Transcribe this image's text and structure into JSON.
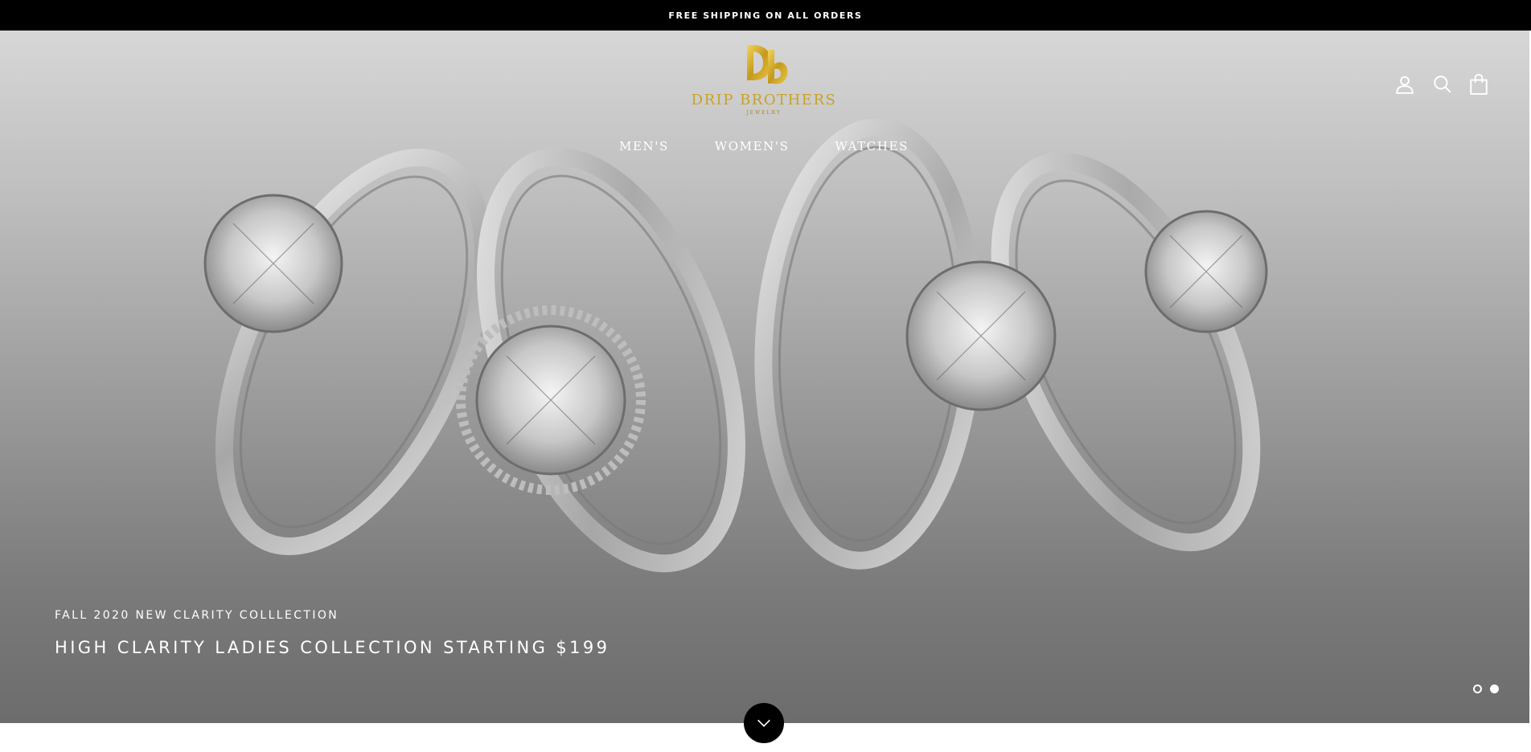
{
  "announcement": {
    "text": "FREE SHIPPING ON ALL ORDERS"
  },
  "header": {
    "logo": {
      "mark": "Db",
      "wordmark": "DRIP BROTHERS",
      "tagline": "JEWELRY"
    },
    "nav": [
      {
        "label": "MEN'S"
      },
      {
        "label": "WOMEN'S"
      },
      {
        "label": "WATCHES"
      }
    ],
    "icons": [
      "account-icon",
      "search-icon",
      "cart-icon"
    ]
  },
  "hero": {
    "subheading": "FALL 2020 NEW CLARITY COLLLECTION",
    "heading": "HIGH CLARITY LADIES COLLECTION STARTING $199",
    "slides": {
      "count": 2,
      "active_index": 2
    }
  },
  "colors": {
    "announcement_bg": "#000000",
    "logo_gold": "#c9a227",
    "hero_text": "#ffffff"
  }
}
